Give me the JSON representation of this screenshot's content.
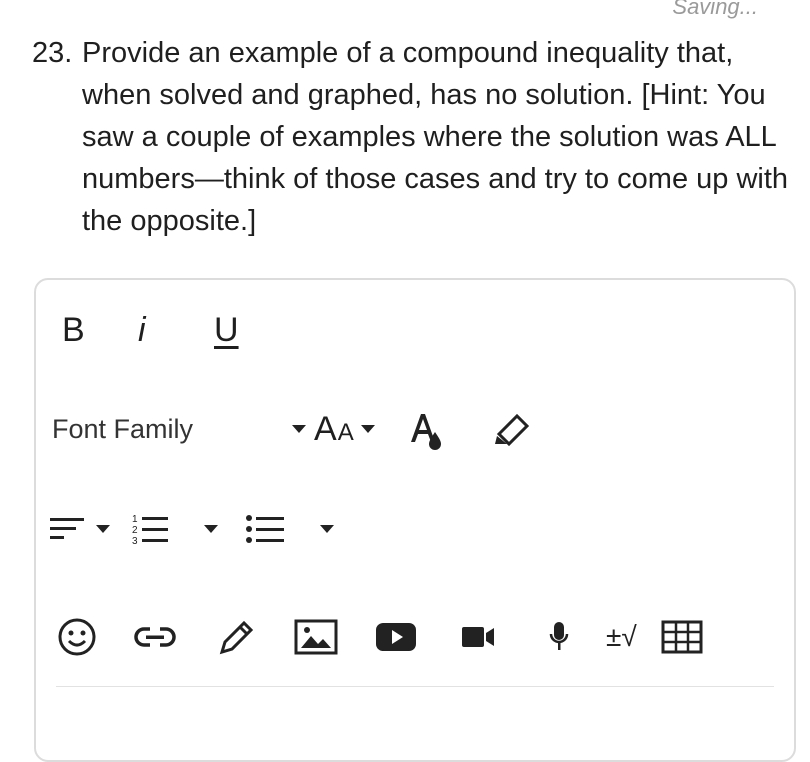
{
  "status": {
    "saving_text": "Saving..."
  },
  "question": {
    "number": "23.",
    "text": "Provide an example of a compound inequality that, when solved and graphed, has no solution. [Hint: You saw a couple of examples where the solution was ALL numbers—think of those cases and try to come up with the opposite.]"
  },
  "toolbar": {
    "bold_label": "B",
    "italic_label": "i",
    "underline_label": "U",
    "font_family_label": "Font Family",
    "font_size_label": "A",
    "font_size_label_small": "A",
    "plus_minus_sqrt": "±√",
    "icons": [
      "bold-icon",
      "italic-icon",
      "underline-icon",
      "font-size-icon",
      "font-color-icon",
      "highlighter-icon",
      "align-icon",
      "ordered-list-icon",
      "bullet-list-icon",
      "emoji-icon",
      "link-icon",
      "pencil-icon",
      "image-icon",
      "youtube-icon",
      "video-icon",
      "microphone-icon",
      "math-icon",
      "table-icon"
    ]
  }
}
